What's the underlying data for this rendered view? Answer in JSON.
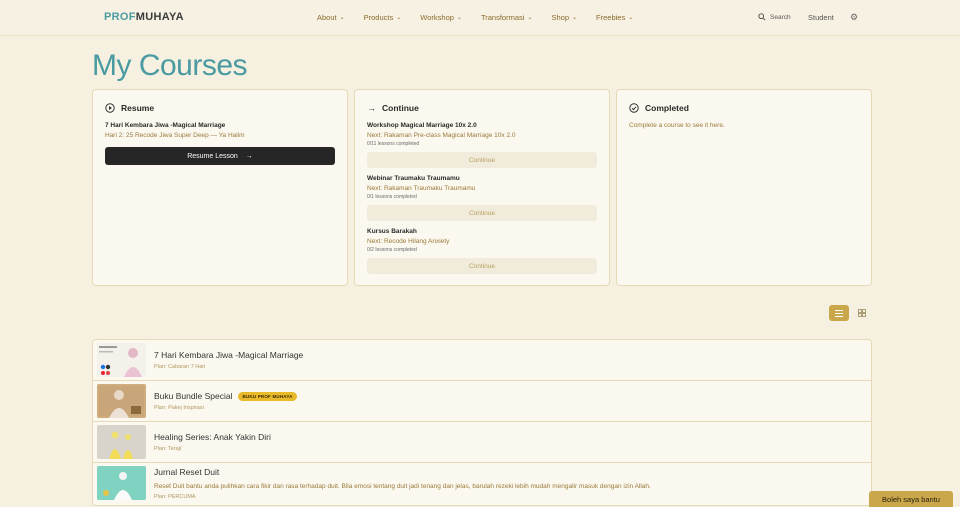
{
  "header": {
    "logo_part1": "PROF",
    "logo_part2": "MUHAYA",
    "nav": [
      {
        "label": "About"
      },
      {
        "label": "Products"
      },
      {
        "label": "Workshop"
      },
      {
        "label": "Transformasi"
      },
      {
        "label": "Shop"
      },
      {
        "label": "Freebies"
      }
    ],
    "search_label": "Search",
    "student_label": "Student"
  },
  "page_title": "My Courses",
  "resume": {
    "heading": "Resume",
    "course_title": "7 Hari Kembara Jiwa -Magical Marriage",
    "lesson": "Hari 2: 25 Recode Jiwa Super Deep — Ya Halim",
    "button_label": "Resume Lesson"
  },
  "continue": {
    "heading": "Continue",
    "items": [
      {
        "title": "Workshop Magical Marriage 10x 2.0",
        "next": "Next: Rakaman Pre-class Magical Marriage 10x 2.0",
        "progress": "0/11 lessons completed",
        "button_label": "Continue"
      },
      {
        "title": "Webinar Traumaku Traumamu",
        "next": "Next: Rakaman Traumaku Traumamu",
        "progress": "0/1 lessons completed",
        "button_label": "Continue"
      },
      {
        "title": "Kursus Barakah",
        "next": "Next: Recode Hilang Anxiety",
        "progress": "0/2 lessons completed",
        "button_label": "Continue"
      }
    ]
  },
  "completed": {
    "heading": "Completed",
    "empty_text": "Complete a course to see it here."
  },
  "courses": [
    {
      "title": "7 Hari Kembara Jiwa -Magical Marriage",
      "plan": "Plan: Cabaran 7 Hari",
      "badge": "",
      "desc": ""
    },
    {
      "title": "Buku Bundle Special",
      "plan": "Plan: Pakej Inspirasi",
      "badge": "BUKU PROF MUHAYA",
      "desc": ""
    },
    {
      "title": "Healing Series: Anak Yakin Diri",
      "plan": "Plan: Teraji",
      "badge": "",
      "desc": ""
    },
    {
      "title": "Jurnal Reset Duit",
      "plan": "Plan: PERCUMA",
      "badge": "",
      "desc": "Reset Duit bantu anda pulihkan cara fikir dan rasa terhadap duit. Bila emosi tentang duit jadi tenang dan jelas, barulah rezeki lebih mudah mengalir masuk dengan izin Allah."
    }
  ],
  "help_label": "Boleh saya bantu",
  "colors": {
    "accent_gold": "#c9a74a",
    "teal_title": "#4a9aa1",
    "background": "#f6f0e1"
  }
}
